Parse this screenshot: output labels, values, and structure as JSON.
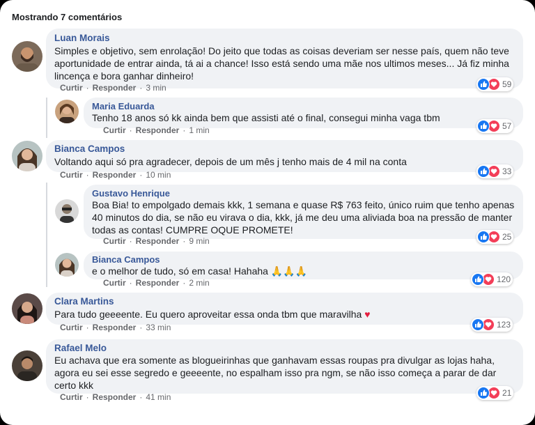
{
  "header": {
    "title": "Mostrando 7 comentários"
  },
  "actions": {
    "like": "Curtir",
    "reply": "Responder",
    "sep": "·"
  },
  "comments": [
    {
      "name": "Luan Morais",
      "text": "Simples e objetivo, sem enrolação! Do jeito que todas as coisas deveriam ser nesse país, quem não teve aportunidade de entrar ainda, tá ai a chance! Isso está sendo uma mãe nos ultimos meses... Já fiz minha lincença e bora ganhar dinheiro!",
      "time": "3 min",
      "count": "59"
    },
    {
      "name": "Maria Eduarda",
      "text": "Tenho 18 anos só kk ainda bem que assisti até o final, consegui minha vaga tbm",
      "time": "1 min",
      "count": "57"
    },
    {
      "name": "Bianca Campos",
      "text": "Voltando aqui só pra agradecer, depois de um mês j tenho mais de 4 mil na conta",
      "time": "10 min",
      "count": "33"
    },
    {
      "name": "Gustavo Henrique",
      "text": "Boa Bia! to empolgado demais kkk, 1 semana e quase R$ 763 feito, único ruim que tenho apenas 40 minutos do dia, se não eu virava o dia, kkk, já me deu uma aliviada boa na pressão de manter todas as contas! CUMPRE OQUE PROMETE!",
      "time": "9 min",
      "count": "25"
    },
    {
      "name": "Bianca Campos",
      "text": "e o melhor de tudo, só em casa! Hahaha 🙏🙏🙏",
      "time": "2 min",
      "count": "120"
    },
    {
      "name": "Clara Martins",
      "text": "Para tudo geeeente. Eu quero aproveitar essa onda tbm que maravilha",
      "heart": "♥",
      "time": "33 min",
      "count": "123"
    },
    {
      "name": "Rafael Melo",
      "text": "Eu achava que era somente as blogueirinhas que ganhavam essas roupas pra divulgar as lojas haha, agora eu sei esse segredo e geeeente, no espalham isso pra ngm, se não isso começa a parar de dar certo kkk",
      "time": "41 min",
      "count": "21"
    }
  ],
  "icons": {
    "like": "thumbs-up-icon",
    "love": "heart-icon"
  },
  "colors": {
    "link": "#385898",
    "like": "#1877f2",
    "love": "#f33e58",
    "bubble": "#f0f2f5"
  }
}
